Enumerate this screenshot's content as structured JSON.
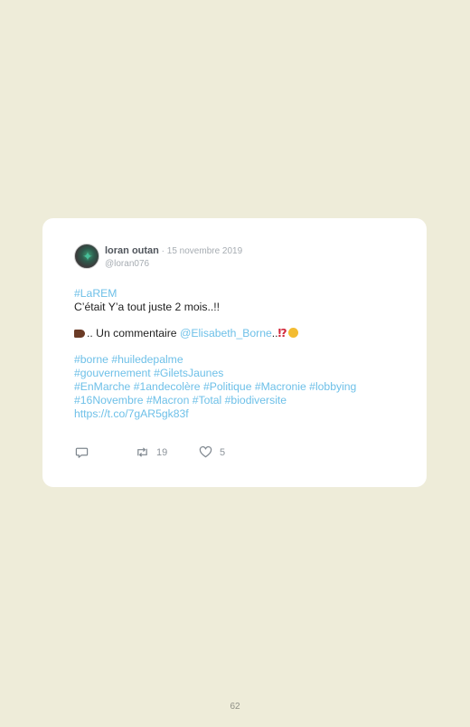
{
  "tweet": {
    "author_name": "loran outan",
    "separator": " · ",
    "date": "15 novembre 2019",
    "handle": "@loran076",
    "lines": {
      "l1": "#LaREM",
      "l2": "C’était Y’a tout juste 2 mois..!!",
      "l3_prefix": ".. Un commentaire ",
      "l3_mention": "@Elisabeth_Borne",
      "l3_suffix": "..",
      "l3_emoji_ex": "⁉",
      "l4": "#borne #huiledepalme",
      "l5": "#gouvernement #GiletsJaunes",
      "l6": "#EnMarche #1andecolère #Politique #Macronie #lobbying",
      "l7": "#16Novembre #Macron #Total #biodiversite",
      "l8": "https://t.co/7gAR5gk83f"
    },
    "actions": {
      "retweets": "19",
      "likes": "5"
    }
  },
  "footer": {
    "page_number": "62"
  },
  "icons": {
    "reply": "reply-icon",
    "retweet": "retweet-icon",
    "like": "heart-icon",
    "hand": "backhand-index-pointing-right-emoji",
    "exclamation_question": "exclamation-question-emoji",
    "thinking": "thinking-face-emoji"
  }
}
